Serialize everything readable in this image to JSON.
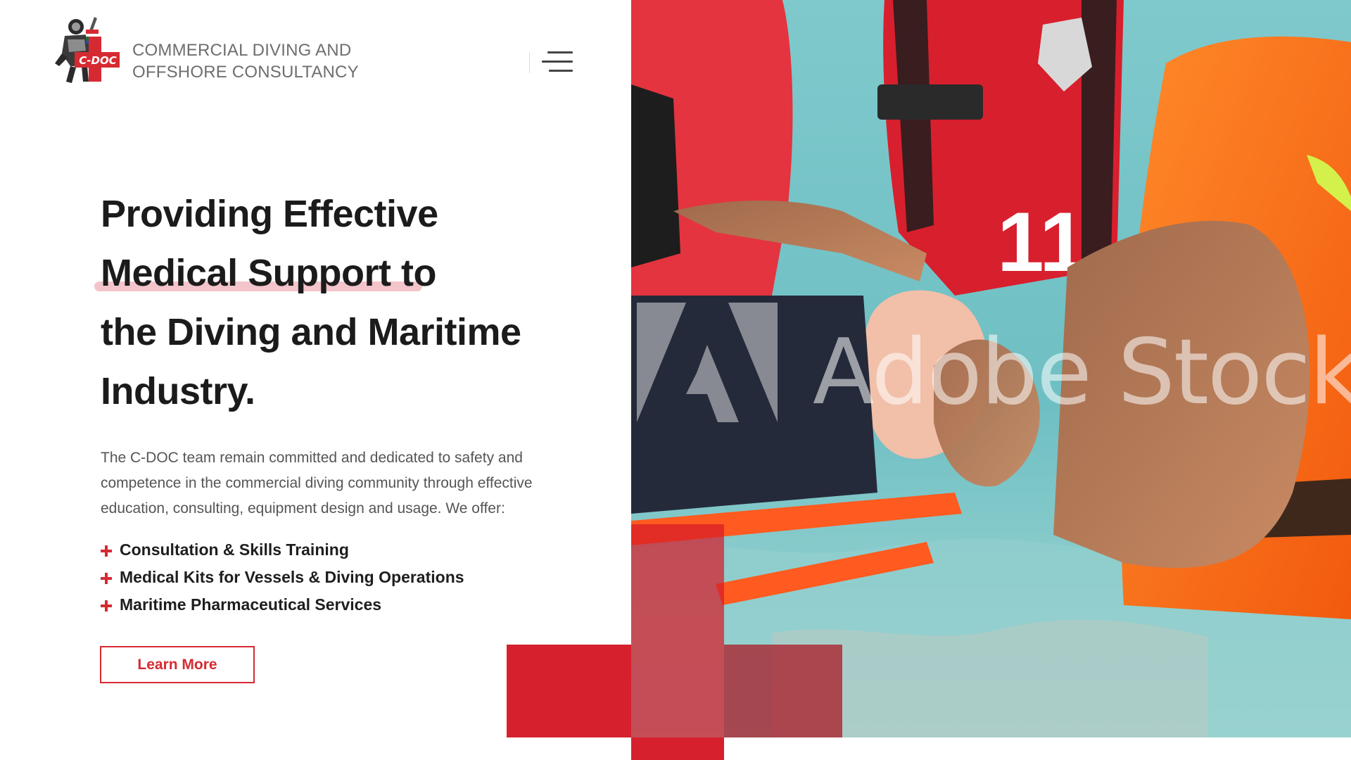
{
  "brand": {
    "logo_text": "C-DOC",
    "name_line1": "COMMERCIAL DIVING AND",
    "name_line2": "OFFSHORE CONSULTANCY"
  },
  "nav": {
    "menu_icon": "hamburger-menu-icon"
  },
  "hero": {
    "headline_lines": [
      "Providing Effective",
      "Medical Support to",
      "the Diving and Maritime",
      "Industry."
    ],
    "intro_lines": [
      "The C-DOC team remain committed and dedicated to safety and",
      "competence in the commercial diving community through effective",
      "education, consulting, equipment design and usage. We offer:"
    ],
    "services": [
      "Consultation & Skills Training",
      "Medical Kits for Vessels & Diving Operations",
      "Maritime Pharmaceutical Services"
    ],
    "cta_label": "Learn More"
  },
  "photo": {
    "watermark": "Adobe Stock",
    "vest_number": "11"
  },
  "colors": {
    "accent": "#d62a32",
    "highlight": "#f4c4cb",
    "headline": "#1b1b1b",
    "body": "#555555"
  }
}
